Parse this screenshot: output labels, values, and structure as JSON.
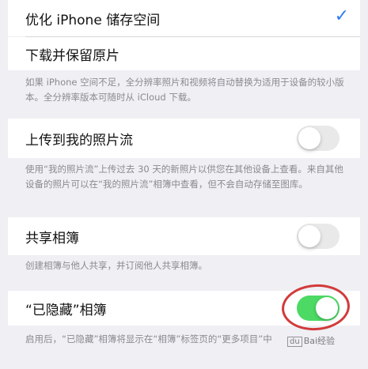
{
  "rows": {
    "optimize_storage": {
      "label": "优化 iPhone 储存空间",
      "selected": true,
      "check_icon": "checkmark-icon"
    },
    "download_keep": {
      "label": "下载并保留原片",
      "selected": false
    },
    "storage_footnote": "如果 iPhone 空间不足，全分辨率照片和视频将自动替换为适用于设备的较小版本。全分辨率版本可随时从 iCloud 下载。",
    "upload_photo_stream": {
      "label": "上传到我的照片流",
      "toggle": "off"
    },
    "photo_stream_footnote": "使用“我的照片流”上传过去 30 天的新照片以供您在其他设备上查看。来自其他设备的照片可以在“我的照片流”相簿中查看，但不会自动存储至图库。",
    "shared_albums": {
      "label": "共享相簿",
      "toggle": "off"
    },
    "shared_footnote": "创建相簿与他人共享，并订阅他人共享相簿。",
    "hidden_album": {
      "label": "“已隐藏”相簿",
      "toggle": "on"
    },
    "hidden_footnote": "启用后，“已隐藏”相簿将显示在“相簿”标签页的“更多项目”中"
  },
  "colors": {
    "accent": "#2f7df6",
    "toggle_on": "#4cd964",
    "toggle_off": "#e9e9ea",
    "annotation": "#d23a3a"
  },
  "watermark": {
    "text": "Bai经验",
    "box": "du"
  }
}
